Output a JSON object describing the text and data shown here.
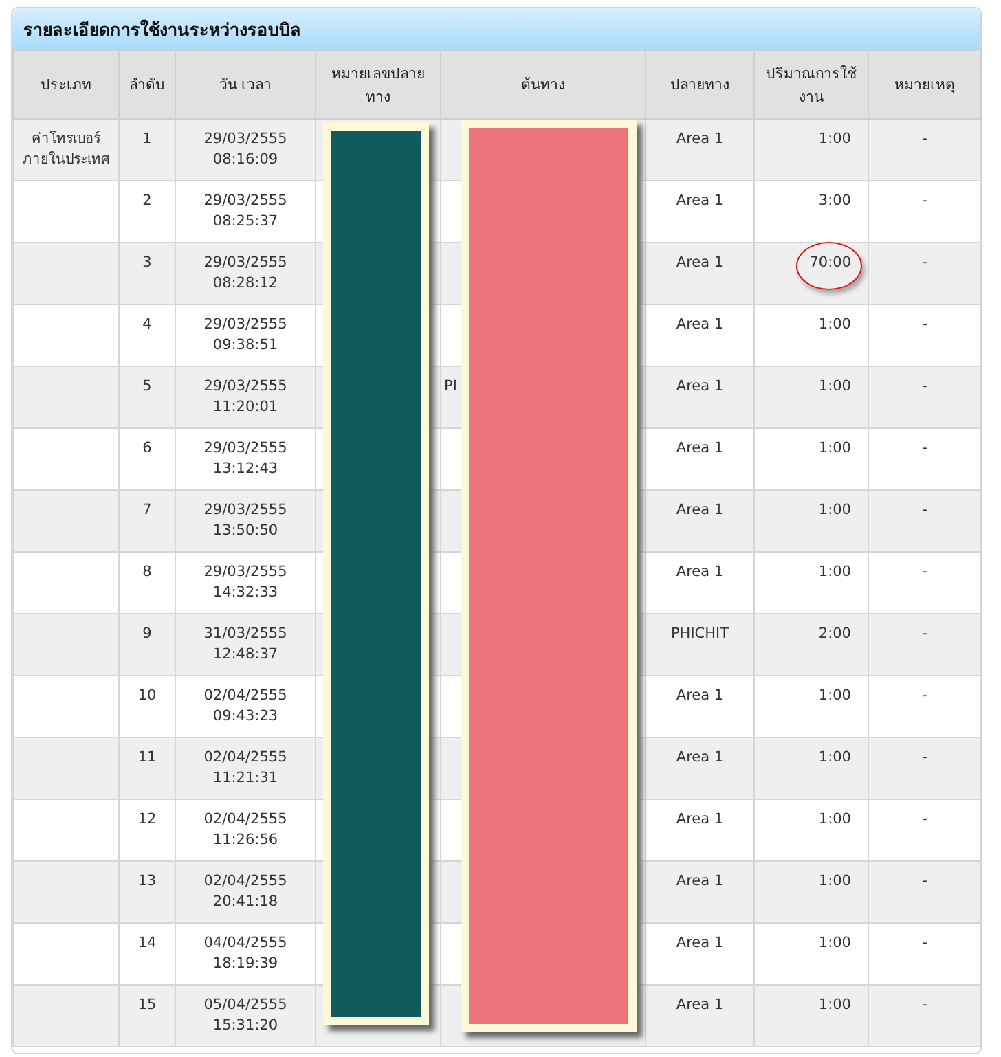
{
  "panel": {
    "title": "รายละเอียดการใช้งานระหว่างรอบบิล"
  },
  "table": {
    "columns": [
      "ประเภท",
      "ลำดับ",
      "วัน เวลา",
      "หมายเลขปลายทาง",
      "ต้นทาง",
      "ปลายทาง",
      "ปริมาณการใช้งาน",
      "หมายเหตุ"
    ],
    "rows": [
      {
        "type": "ค่าโทรเบอร์\nภายในประเทศ",
        "index": "1",
        "datetime": "29/03/2555\n08:16:09",
        "destination": "Area 1",
        "usage": "1:00",
        "note": "-",
        "circled": false
      },
      {
        "index": "2",
        "datetime": "29/03/2555\n08:25:37",
        "destination": "Area 1",
        "usage": "3:00",
        "note": "-",
        "circled": false
      },
      {
        "index": "3",
        "datetime": "29/03/2555\n08:28:12",
        "destination": "Area 1",
        "usage": "70:00",
        "note": "-",
        "circled": true
      },
      {
        "index": "4",
        "datetime": "29/03/2555\n09:38:51",
        "destination": "Area 1",
        "usage": "1:00",
        "note": "-",
        "circled": false
      },
      {
        "index": "5",
        "datetime": "29/03/2555\n11:20:01",
        "origin": "PI",
        "destination": "Area 1",
        "usage": "1:00",
        "note": "-",
        "circled": false
      },
      {
        "index": "6",
        "datetime": "29/03/2555\n13:12:43",
        "destination": "Area 1",
        "usage": "1:00",
        "note": "-",
        "circled": false
      },
      {
        "index": "7",
        "datetime": "29/03/2555\n13:50:50",
        "destination": "Area 1",
        "usage": "1:00",
        "note": "-",
        "circled": false
      },
      {
        "index": "8",
        "datetime": "29/03/2555\n14:32:33",
        "destination": "Area 1",
        "usage": "1:00",
        "note": "-",
        "circled": false
      },
      {
        "index": "9",
        "datetime": "31/03/2555\n12:48:37",
        "destination": "PHICHIT",
        "usage": "2:00",
        "note": "-",
        "circled": false
      },
      {
        "index": "10",
        "datetime": "02/04/2555\n09:43:23",
        "destination": "Area 1",
        "usage": "1:00",
        "note": "-",
        "circled": false
      },
      {
        "index": "11",
        "datetime": "02/04/2555\n11:21:31",
        "destination": "Area 1",
        "usage": "1:00",
        "note": "-",
        "circled": false
      },
      {
        "index": "12",
        "datetime": "02/04/2555\n11:26:56",
        "destination": "Area 1",
        "usage": "1:00",
        "note": "-",
        "circled": false
      },
      {
        "index": "13",
        "datetime": "02/04/2555\n20:41:18",
        "destination": "Area 1",
        "usage": "1:00",
        "note": "-",
        "circled": false
      },
      {
        "index": "14",
        "datetime": "04/04/2555\n18:19:39",
        "destination": "Area 1",
        "usage": "1:00",
        "note": "-",
        "circled": false
      },
      {
        "index": "15",
        "datetime": "05/04/2555\n15:31:20",
        "destination": "Area 1",
        "usage": "1:00",
        "note": "-",
        "circled": false
      }
    ]
  },
  "redactions": [
    {
      "color": "#115a5e"
    },
    {
      "color": "#ec7379"
    }
  ]
}
